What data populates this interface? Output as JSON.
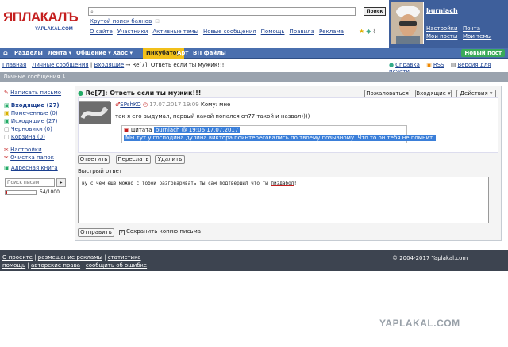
{
  "logo": {
    "main": "ЯПЛАКАЛЪ",
    "sub": "YAPLAKAL.COM"
  },
  "search": {
    "value": "",
    "button": "Поиск",
    "sub_link": "Крутой поиск баянов",
    "sub_dot": "⊡"
  },
  "top_nav": [
    "О сайте",
    "Участники",
    "Активные темы",
    "Новые сообщения",
    "Помощь",
    "Правила",
    "Реклама"
  ],
  "user": {
    "name": "burnlach",
    "links": [
      [
        "Настройки",
        "Почта"
      ],
      [
        "Мои посты",
        "Мои темы"
      ]
    ]
  },
  "nav": {
    "items": [
      "Разделы",
      "Лента ▾",
      "Общение ▾",
      "Хаос ▾",
      "Инкубатор",
      "Арт",
      "ВП файлы"
    ],
    "new_post": "Новый пост"
  },
  "breadcrumb": {
    "items": [
      "Главная",
      "Личные сообщения",
      "Входящие"
    ],
    "sep": "→",
    "current": "Re[7]: Ответь если ты мужик!!!"
  },
  "breadcrumb_right": [
    "Справка",
    "RSS",
    "Версия для печати"
  ],
  "pm_bar": "Личные сообщения ↓",
  "sidebar": {
    "compose": "Написать письмо",
    "folders": [
      {
        "label": "Входящие (27)",
        "bold": true
      },
      {
        "label": "Помеченные (0)"
      },
      {
        "label": "Исходящие (27)"
      },
      {
        "label": "Черновики (0)"
      },
      {
        "label": "Корзина (0)"
      }
    ],
    "settings": "Настройки",
    "clean": "Очистка папок",
    "address": "Адресная книга",
    "search_placeholder": "Поиск писем",
    "search_btn": "▸",
    "quota_text": "54/1000",
    "quota_fill": 0.054
  },
  "message": {
    "title": "Re[7]: Ответь если ты мужик!!!",
    "buttons": {
      "complain": "Пожаловаться",
      "folder": "Входящие ▾",
      "actions": "Действия ▾"
    },
    "author": "SPshKO",
    "date": "17.07.2017 19:09",
    "to": "Кому: мне",
    "text": "так я его выдумал, первый какой попался сп77 такой и назвал))))",
    "quote_label": "Цитата",
    "quote_head": "burnlach @ 19:06 17.07.2017",
    "quote_text": "Мы тут у господина дулина виктора поинтересовались по твоему позывному. Что то он тебя не помнит."
  },
  "actions": {
    "reply": "Ответить",
    "forward": "Переслать",
    "delete": "Удалить"
  },
  "quick_reply": {
    "label": "Быстрый ответ",
    "text": "ну с чем еще можно с тобой разговаривать ты сам подтвердил что ты ",
    "text_u": "пиздабол",
    "text_end": "!",
    "send": "Отправить",
    "keep": "Сохранить копию письма",
    "keep_mark": "✓"
  },
  "footer": {
    "line1": [
      "О проекте",
      "размещение рекламы",
      "статистика"
    ],
    "line2": [
      "помощь",
      "авторские права",
      "сообщить об ошибке"
    ],
    "copyright": "© 2004-2017",
    "copyright_link": "Yaplakal.com"
  },
  "watermark": "YAPLAKAL.COM"
}
